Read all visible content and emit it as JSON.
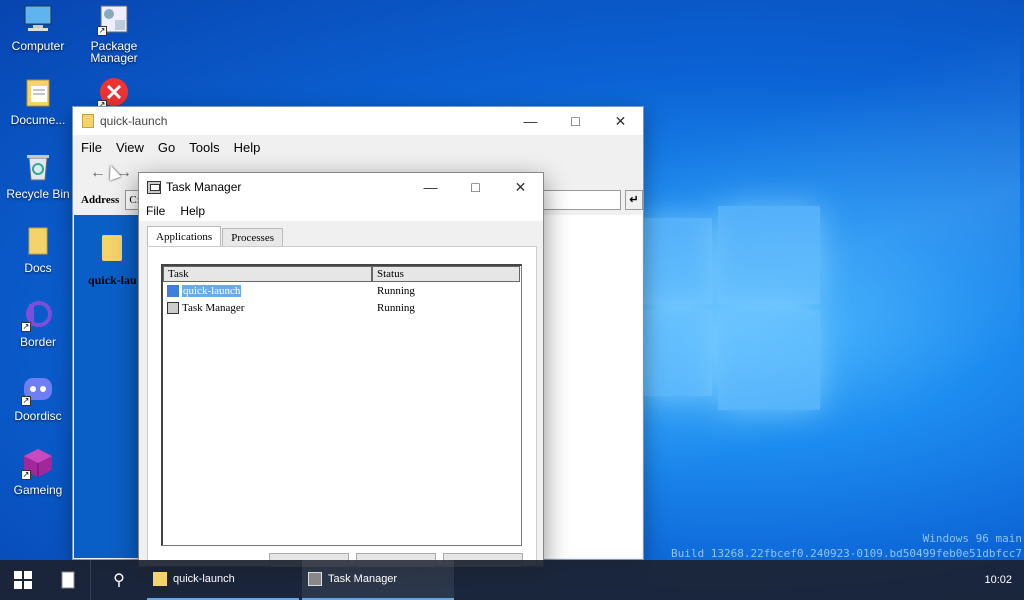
{
  "desktop": {
    "icons": [
      {
        "label": "Computer"
      },
      {
        "label": "Package Manager"
      },
      {
        "label": "Docume..."
      },
      {
        "label": "Recycle Bin"
      },
      {
        "label": "Docs"
      },
      {
        "label": "Border"
      },
      {
        "label": "Doordisc"
      },
      {
        "label": "Gameing"
      }
    ],
    "watermark_line1": "Windows 96 main",
    "watermark_line2": "Build 13268.22fbcef0.240923-0109.bd50499feb0e51dbfcc7"
  },
  "explorer": {
    "title": "quick-launch",
    "menu": [
      "File",
      "View",
      "Go",
      "Tools",
      "Help"
    ],
    "address_label": "Address",
    "address_value": "C:",
    "folder_label": "quick-lau"
  },
  "taskmgr": {
    "title": "Task Manager",
    "menu": [
      "File",
      "Help"
    ],
    "tabs": [
      "Applications",
      "Processes"
    ],
    "columns": [
      "Task",
      "Status"
    ],
    "rows": [
      {
        "task": "quick-launch",
        "status": "Running"
      },
      {
        "task": "Task Manager",
        "status": "Running"
      }
    ]
  },
  "taskbar": {
    "items": [
      {
        "label": "quick-launch"
      },
      {
        "label": "Task Manager"
      }
    ],
    "clock": "10:02"
  },
  "colors": {
    "accent": "#0a5fc7",
    "selection": "#6ba9e8",
    "folder": "#f5d36b"
  }
}
